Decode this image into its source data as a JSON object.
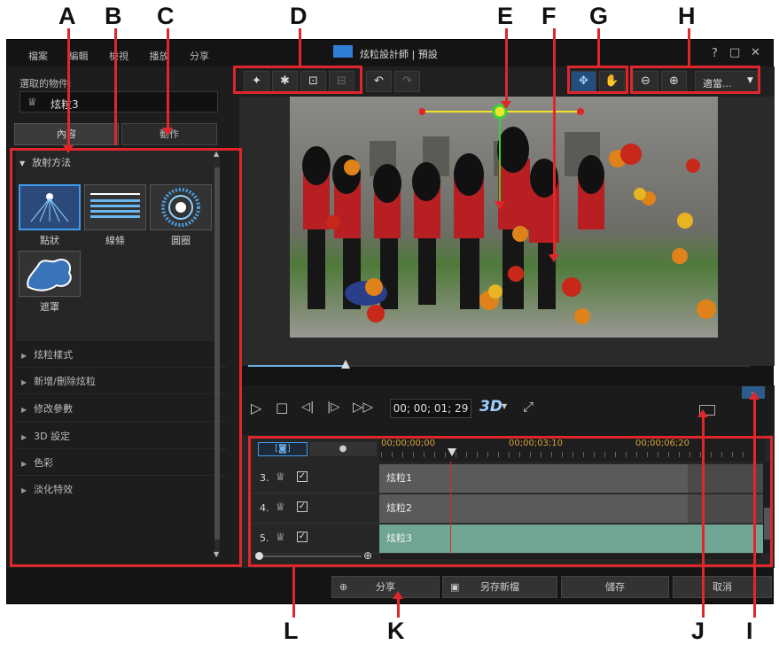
{
  "callouts": [
    "A",
    "B",
    "C",
    "D",
    "E",
    "F",
    "G",
    "H",
    "I",
    "J",
    "K",
    "L"
  ],
  "window": {
    "title": "炫粒設計師 | 預設",
    "help": "?",
    "restore": "□",
    "close": "✕"
  },
  "menu": [
    "檔案",
    "編輯",
    "檢視",
    "播放",
    "分享"
  ],
  "left": {
    "selected_label": "選取的物件:",
    "selected_value": "炫粒3",
    "tab_content": "內容",
    "tab_motion": "動作",
    "emission_header": "放射方法",
    "emitters": [
      "點狀",
      "線條",
      "圓圈",
      "遮罩"
    ],
    "sections": [
      "炫粒樣式",
      "新增/刪除炫粒",
      "修改參數",
      "3D 設定",
      "色彩",
      "淡化特效"
    ]
  },
  "toolbar": {
    "zoom": "適當..."
  },
  "player": {
    "timecode": "00; 00; 01; 29",
    "mode3d": "3D"
  },
  "timeline": {
    "ruler": [
      "00;00;00;00",
      "00;00;03;10",
      "00;00;06;20"
    ],
    "tracks": [
      {
        "num": "3.",
        "clip": "炫粒1"
      },
      {
        "num": "4.",
        "clip": "炫粒2"
      },
      {
        "num": "5.",
        "clip": "炫粒3"
      }
    ]
  },
  "bottom": {
    "share": "分享",
    "save_as": "另存新檔",
    "save": "儲存",
    "cancel": "取消"
  },
  "colors": {
    "accent": "#e0262a",
    "track_selected": "#6fa593",
    "clip": "#5a5a5a",
    "yellow_handle": "#f2e22a",
    "green_handle": "#3ad13a"
  }
}
